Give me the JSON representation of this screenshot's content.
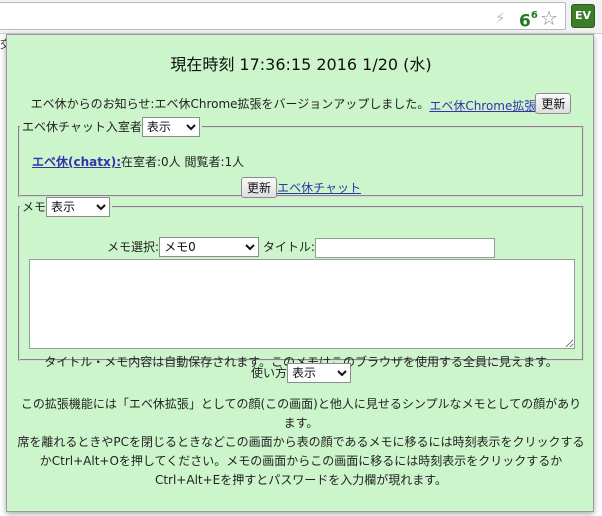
{
  "browser": {
    "badge_count": "6",
    "badge_sup": "6",
    "extension_label": "EV",
    "page_glyph": "交"
  },
  "icons": {
    "bolt": "lightning-bolt",
    "star": "bookmark-star",
    "extension": "eveq-extension"
  },
  "colors": {
    "popup_bg": "#ccf5cc",
    "link": "#3333aa",
    "extension_bg": "#3c7d2a"
  },
  "clock": {
    "text": "現在時刻 17:36:15 2016 1/20 (水)"
  },
  "notice": {
    "text": "エベ休からのお知らせ:エベ休Chrome拡張をバージョンアップしました。",
    "link_text": "エベ休Chrome拡張",
    "refresh_label": "更新"
  },
  "chat": {
    "legend": "エベ休チャット入室者",
    "select_value": "表示",
    "room_link": "エベ休(chatx):",
    "counts": "在室者:0人 閲覧者:1人",
    "refresh_label": "更新",
    "chat_link": "エベ休チャット"
  },
  "memo": {
    "legend": "メモ",
    "select_value": "表示",
    "memo_select_label": "メモ選択:",
    "memo_select_value": "メモ0",
    "title_label": "タイトル:",
    "title_value": "",
    "content": "",
    "note": "タイトル・メモ内容は自動保存されます。このメモはこのブラウザを使用する全員に見えます。"
  },
  "usage": {
    "label": "使い方",
    "select_value": "表示"
  },
  "description": {
    "line1": "この拡張機能には「エベ休拡張」としての顔(この画面)と他人に見せるシンプルなメモとしての顔があります。",
    "line2": "席を離れるときやPCを閉じるときなどこの画面から表の顔であるメモに移るには時刻表示をクリックするかCtrl+Alt+Oを押してください。メモの画面からこの画面に移るには時刻表示をクリックするかCtrl+Alt+Eを押すとパスワードを入力欄が現れます。"
  }
}
